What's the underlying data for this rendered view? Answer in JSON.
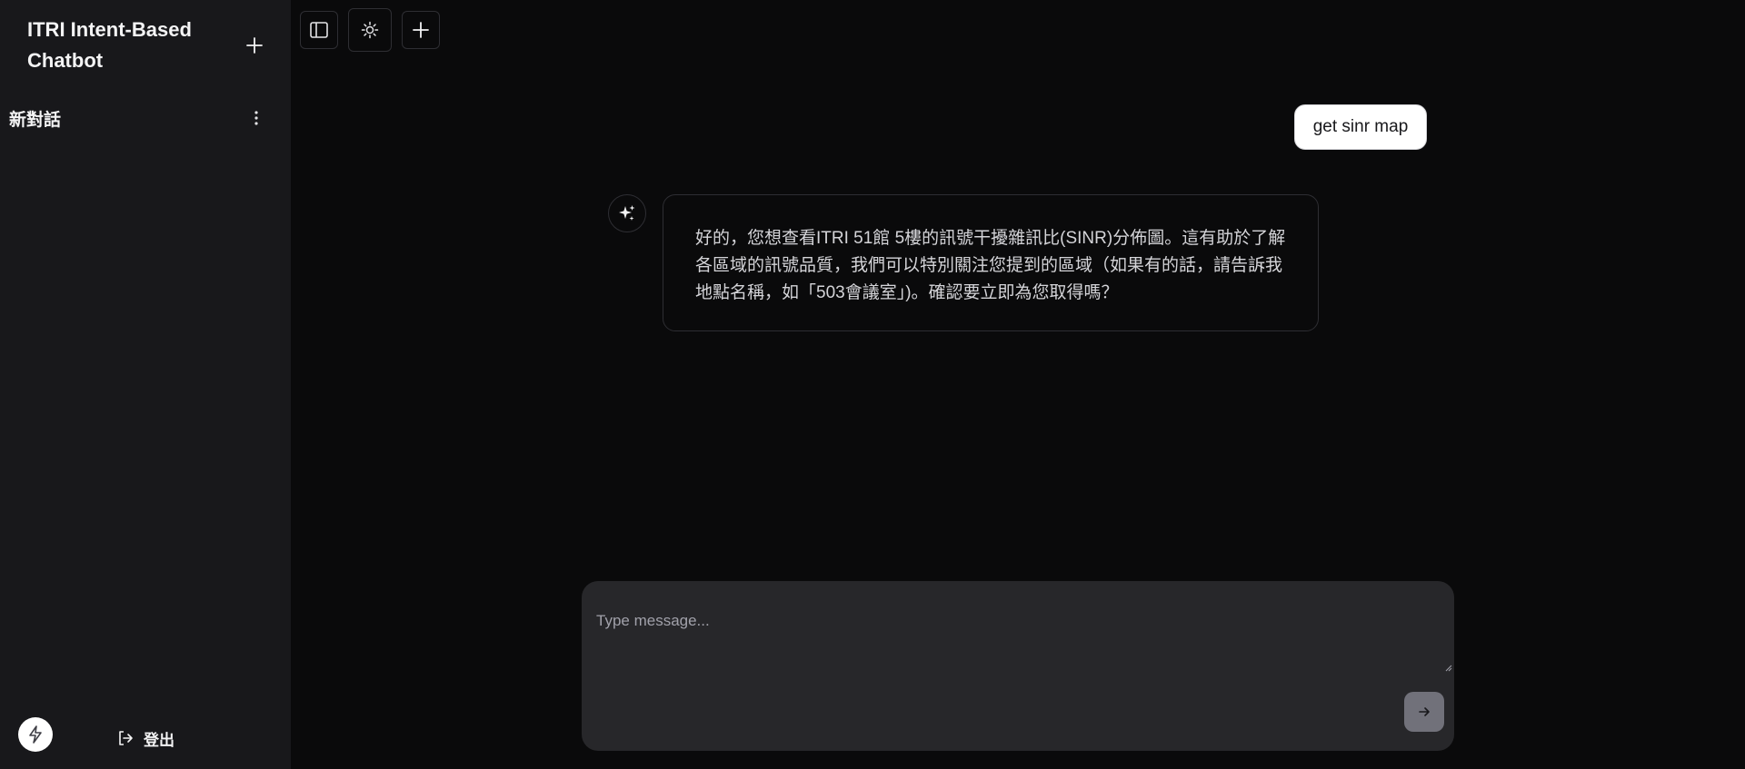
{
  "sidebar": {
    "app_title": "ITRI Intent-Based Chatbot",
    "conversations": [
      {
        "label": "新對話"
      }
    ],
    "logout_label": "登出"
  },
  "toolbar": {
    "buttons": [
      "toggle-sidebar",
      "theme-toggle",
      "new-chat"
    ]
  },
  "chat": {
    "user_message": "get sinr map",
    "assistant_message": "好的，您想查看ITRI 51館 5樓的訊號干擾雜訊比(SINR)分佈圖。這有助於了解各區域的訊號品質，我們可以特別關注您提到的區域（如果有的話，請告訴我地點名稱，如「503會議室」)。確認要立即為您取得嗎？"
  },
  "composer": {
    "placeholder": "Type message..."
  },
  "icons": {
    "new_chat": "plus-icon",
    "conversation_menu": "more-vertical-icon",
    "toggle_sidebar": "sidebar-panel-icon",
    "theme": "sun-icon",
    "assistant": "sparkles-icon",
    "avatar": "bolt-icon",
    "logout": "logout-icon",
    "send": "arrow-right-icon"
  }
}
